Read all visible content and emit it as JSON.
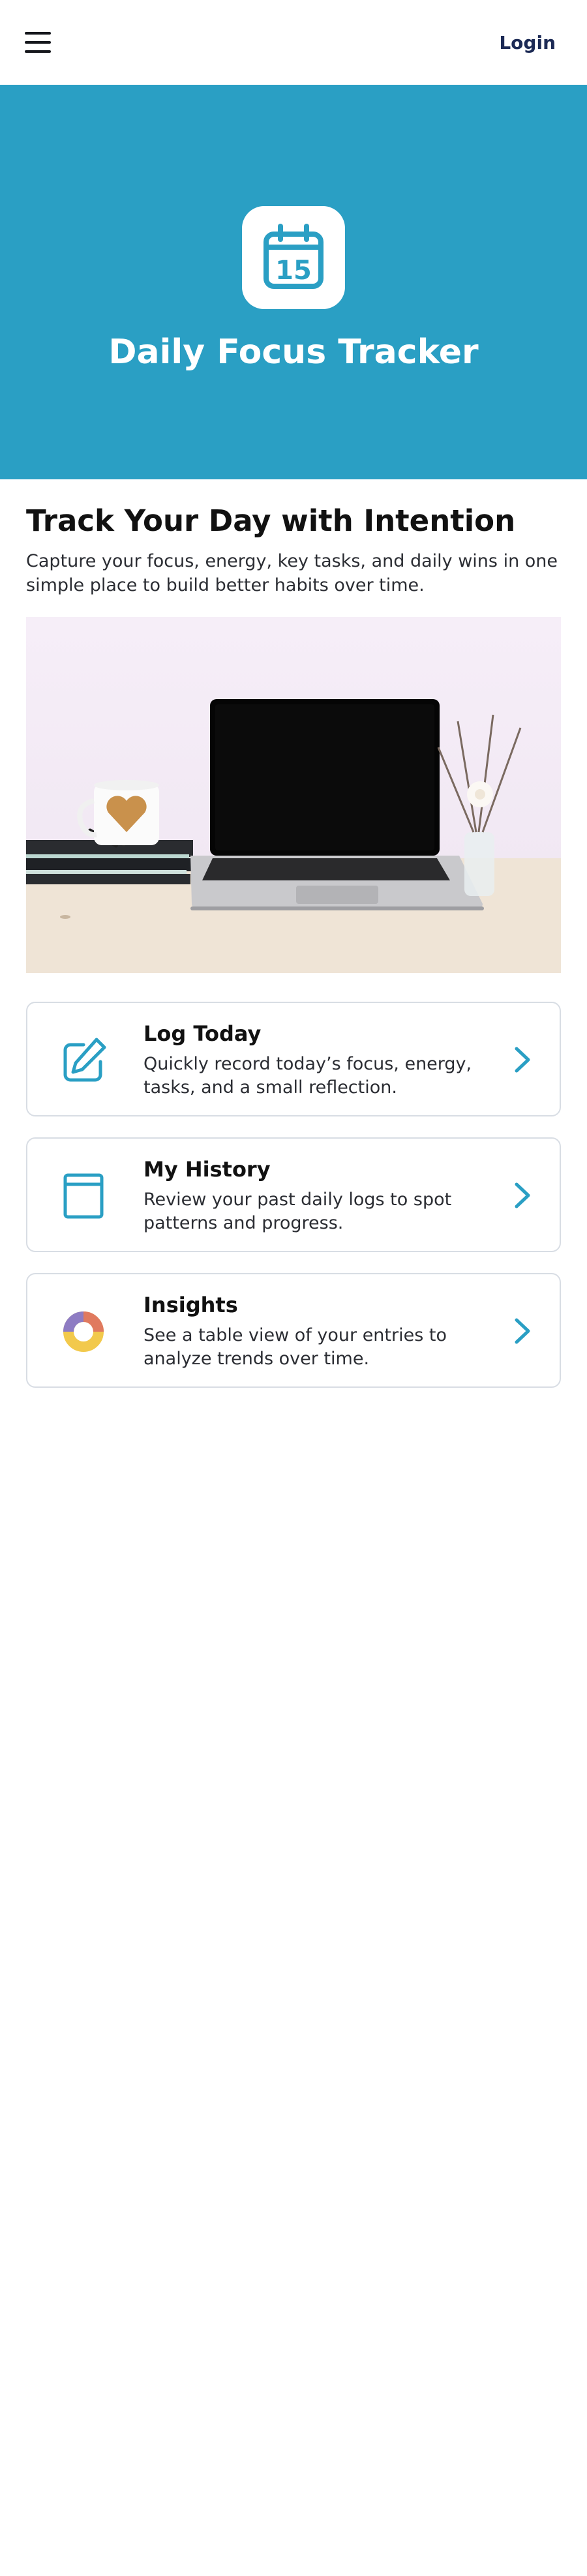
{
  "header": {
    "menu_icon": "hamburger-menu-icon",
    "login_label": "Login"
  },
  "hero": {
    "icon": "calendar-icon",
    "calendar_day": "15",
    "title": "Daily Focus Tracker",
    "background_color": "#2a9fc4"
  },
  "intro": {
    "title": "Track Your Day with Intention",
    "text": "Capture your focus, energy, key tasks, and daily wins in one simple place to build better habits over time."
  },
  "cards": [
    {
      "title": "Log Today",
      "description": "Quickly record today’s focus, energy, tasks, and a small reflection.",
      "icon": "pencil-edit-icon"
    },
    {
      "title": "My History",
      "description": "Review your past daily logs to spot patterns and progress.",
      "icon": "book-icon"
    },
    {
      "title": "Insights",
      "description": "See a table view of your entries to analyze trends over time.",
      "icon": "donut-chart-icon"
    }
  ],
  "colors": {
    "accent": "#2a9fc4",
    "nav_text": "#1c2a55"
  }
}
